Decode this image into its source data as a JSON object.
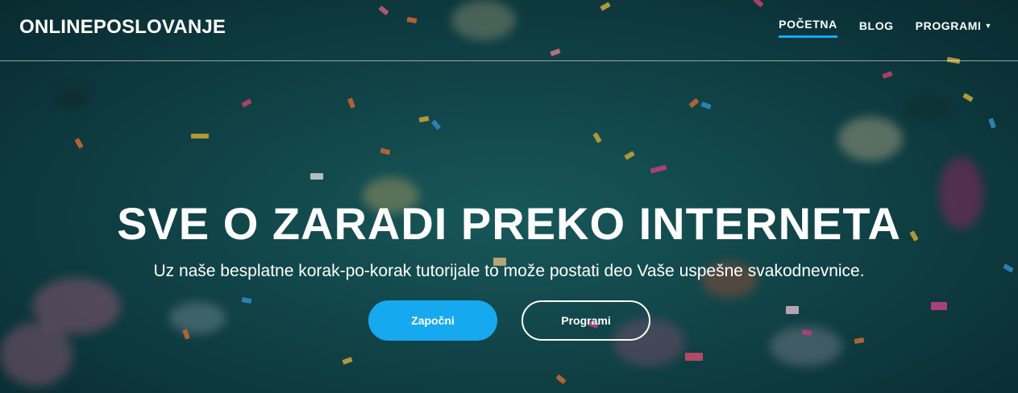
{
  "brand": "ONLINEPOSLOVANJE",
  "nav": {
    "items": [
      {
        "label": "POČETNA",
        "active": true
      },
      {
        "label": "BLOG",
        "active": false
      },
      {
        "label": "PROGRAMI",
        "active": false,
        "dropdown": true
      }
    ]
  },
  "hero": {
    "title": "SVE O ZARADI PREKO INTERNETA",
    "subtitle": "Uz naše besplatne korak-po-korak tutorijale to može postati deo Vaše uspešne svakodnevnice.",
    "primary_button": "Započni",
    "secondary_button": "Programi"
  },
  "colors": {
    "accent": "#17a9f0",
    "background": "#154f53",
    "text": "#ffffff"
  },
  "icons": {
    "dropdown": "chevron-down-icon"
  }
}
